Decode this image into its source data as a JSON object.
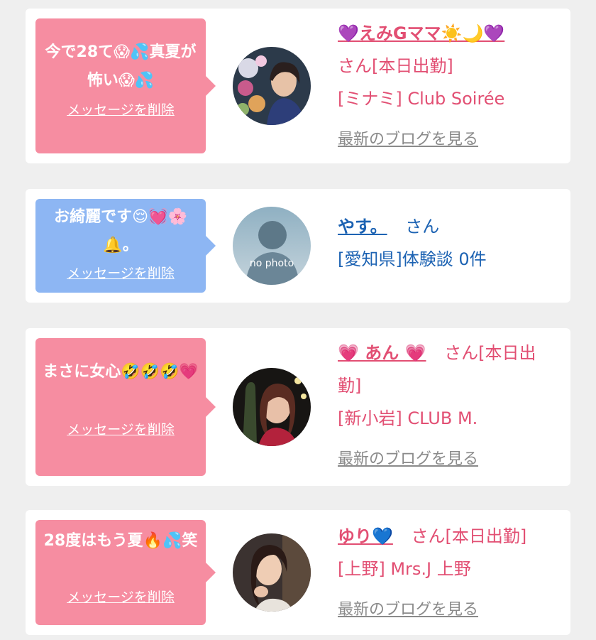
{
  "cards": [
    {
      "message": "今で28て😱💦真夏が怖い😱💦",
      "delete_label": "メッセージを削除",
      "name": "💜えみGママ☀️🌙💜",
      "san": "さん[本日出勤]",
      "store": "[ミナミ] Club Soirée",
      "blog_label": "最新のブログを見る"
    },
    {
      "message": "お綺麗です😌💓🌸🔔。",
      "delete_label": "メッセージを削除",
      "name": "やす。",
      "san": "さん",
      "store": "[愛知県]体験談 0件",
      "avatar_text": "no photo"
    },
    {
      "message": "まさに女心🤣🤣🤣💗",
      "delete_label": "メッセージを削除",
      "name": "💗 あん 💗",
      "san": "さん[本日出勤]",
      "store": "[新小岩] CLUB M.",
      "blog_label": "最新のブログを見る"
    },
    {
      "message": "28度はもう夏🔥💦笑",
      "delete_label": "メッセージを削除",
      "name": "ゆり💙",
      "san": "さん[本日出勤]",
      "store": "[上野] Mrs.J 上野",
      "blog_label": "最新のブログを見る"
    }
  ],
  "colors": {
    "pink_bubble": "#f68da1",
    "blue_bubble": "#8db6f3",
    "pink_text": "#e24f73",
    "blue_text": "#1d63b3",
    "link_gray": "#8a8a8a",
    "background": "#efefef"
  }
}
